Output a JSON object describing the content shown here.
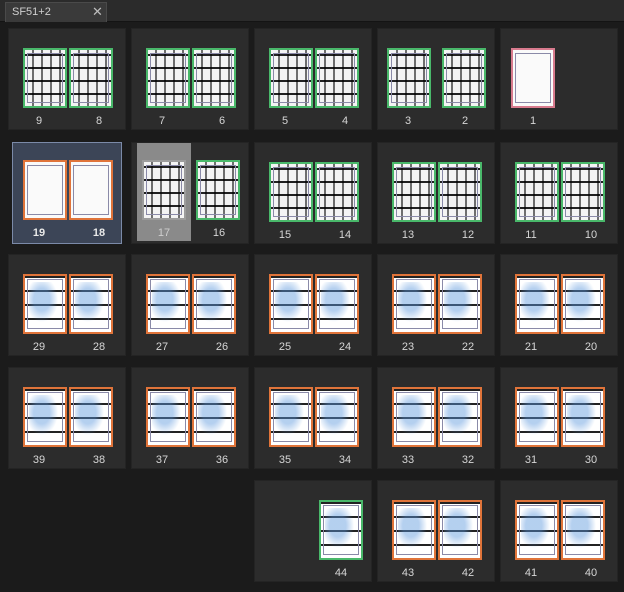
{
  "tab": {
    "title": "SF51+2",
    "close_glyph": "✕"
  },
  "pages": {
    "p9": "9",
    "p8": "8",
    "p7": "7",
    "p6": "6",
    "p5": "5",
    "p4": "4",
    "p3": "3",
    "p2": "2",
    "p1": "1",
    "p19": "19",
    "p18": "18",
    "p17": "17",
    "p16": "16",
    "p15": "15",
    "p14": "14",
    "p13": "13",
    "p12": "12",
    "p11": "11",
    "p10": "10",
    "p29": "29",
    "p28": "28",
    "p27": "27",
    "p26": "26",
    "p25": "25",
    "p24": "24",
    "p23": "23",
    "p22": "22",
    "p21": "21",
    "p20": "20",
    "p39": "39",
    "p38": "38",
    "p37": "37",
    "p36": "36",
    "p35": "35",
    "p34": "34",
    "p33": "33",
    "p32": "32",
    "p31": "31",
    "p30": "30",
    "p44": "44",
    "p43": "43",
    "p42": "42",
    "p41": "41",
    "p40": "40"
  },
  "colors": {
    "finished": "#49b86a",
    "draft": "#e0743a",
    "cover": "#d87b8e",
    "selected": "#7b8aa8"
  }
}
